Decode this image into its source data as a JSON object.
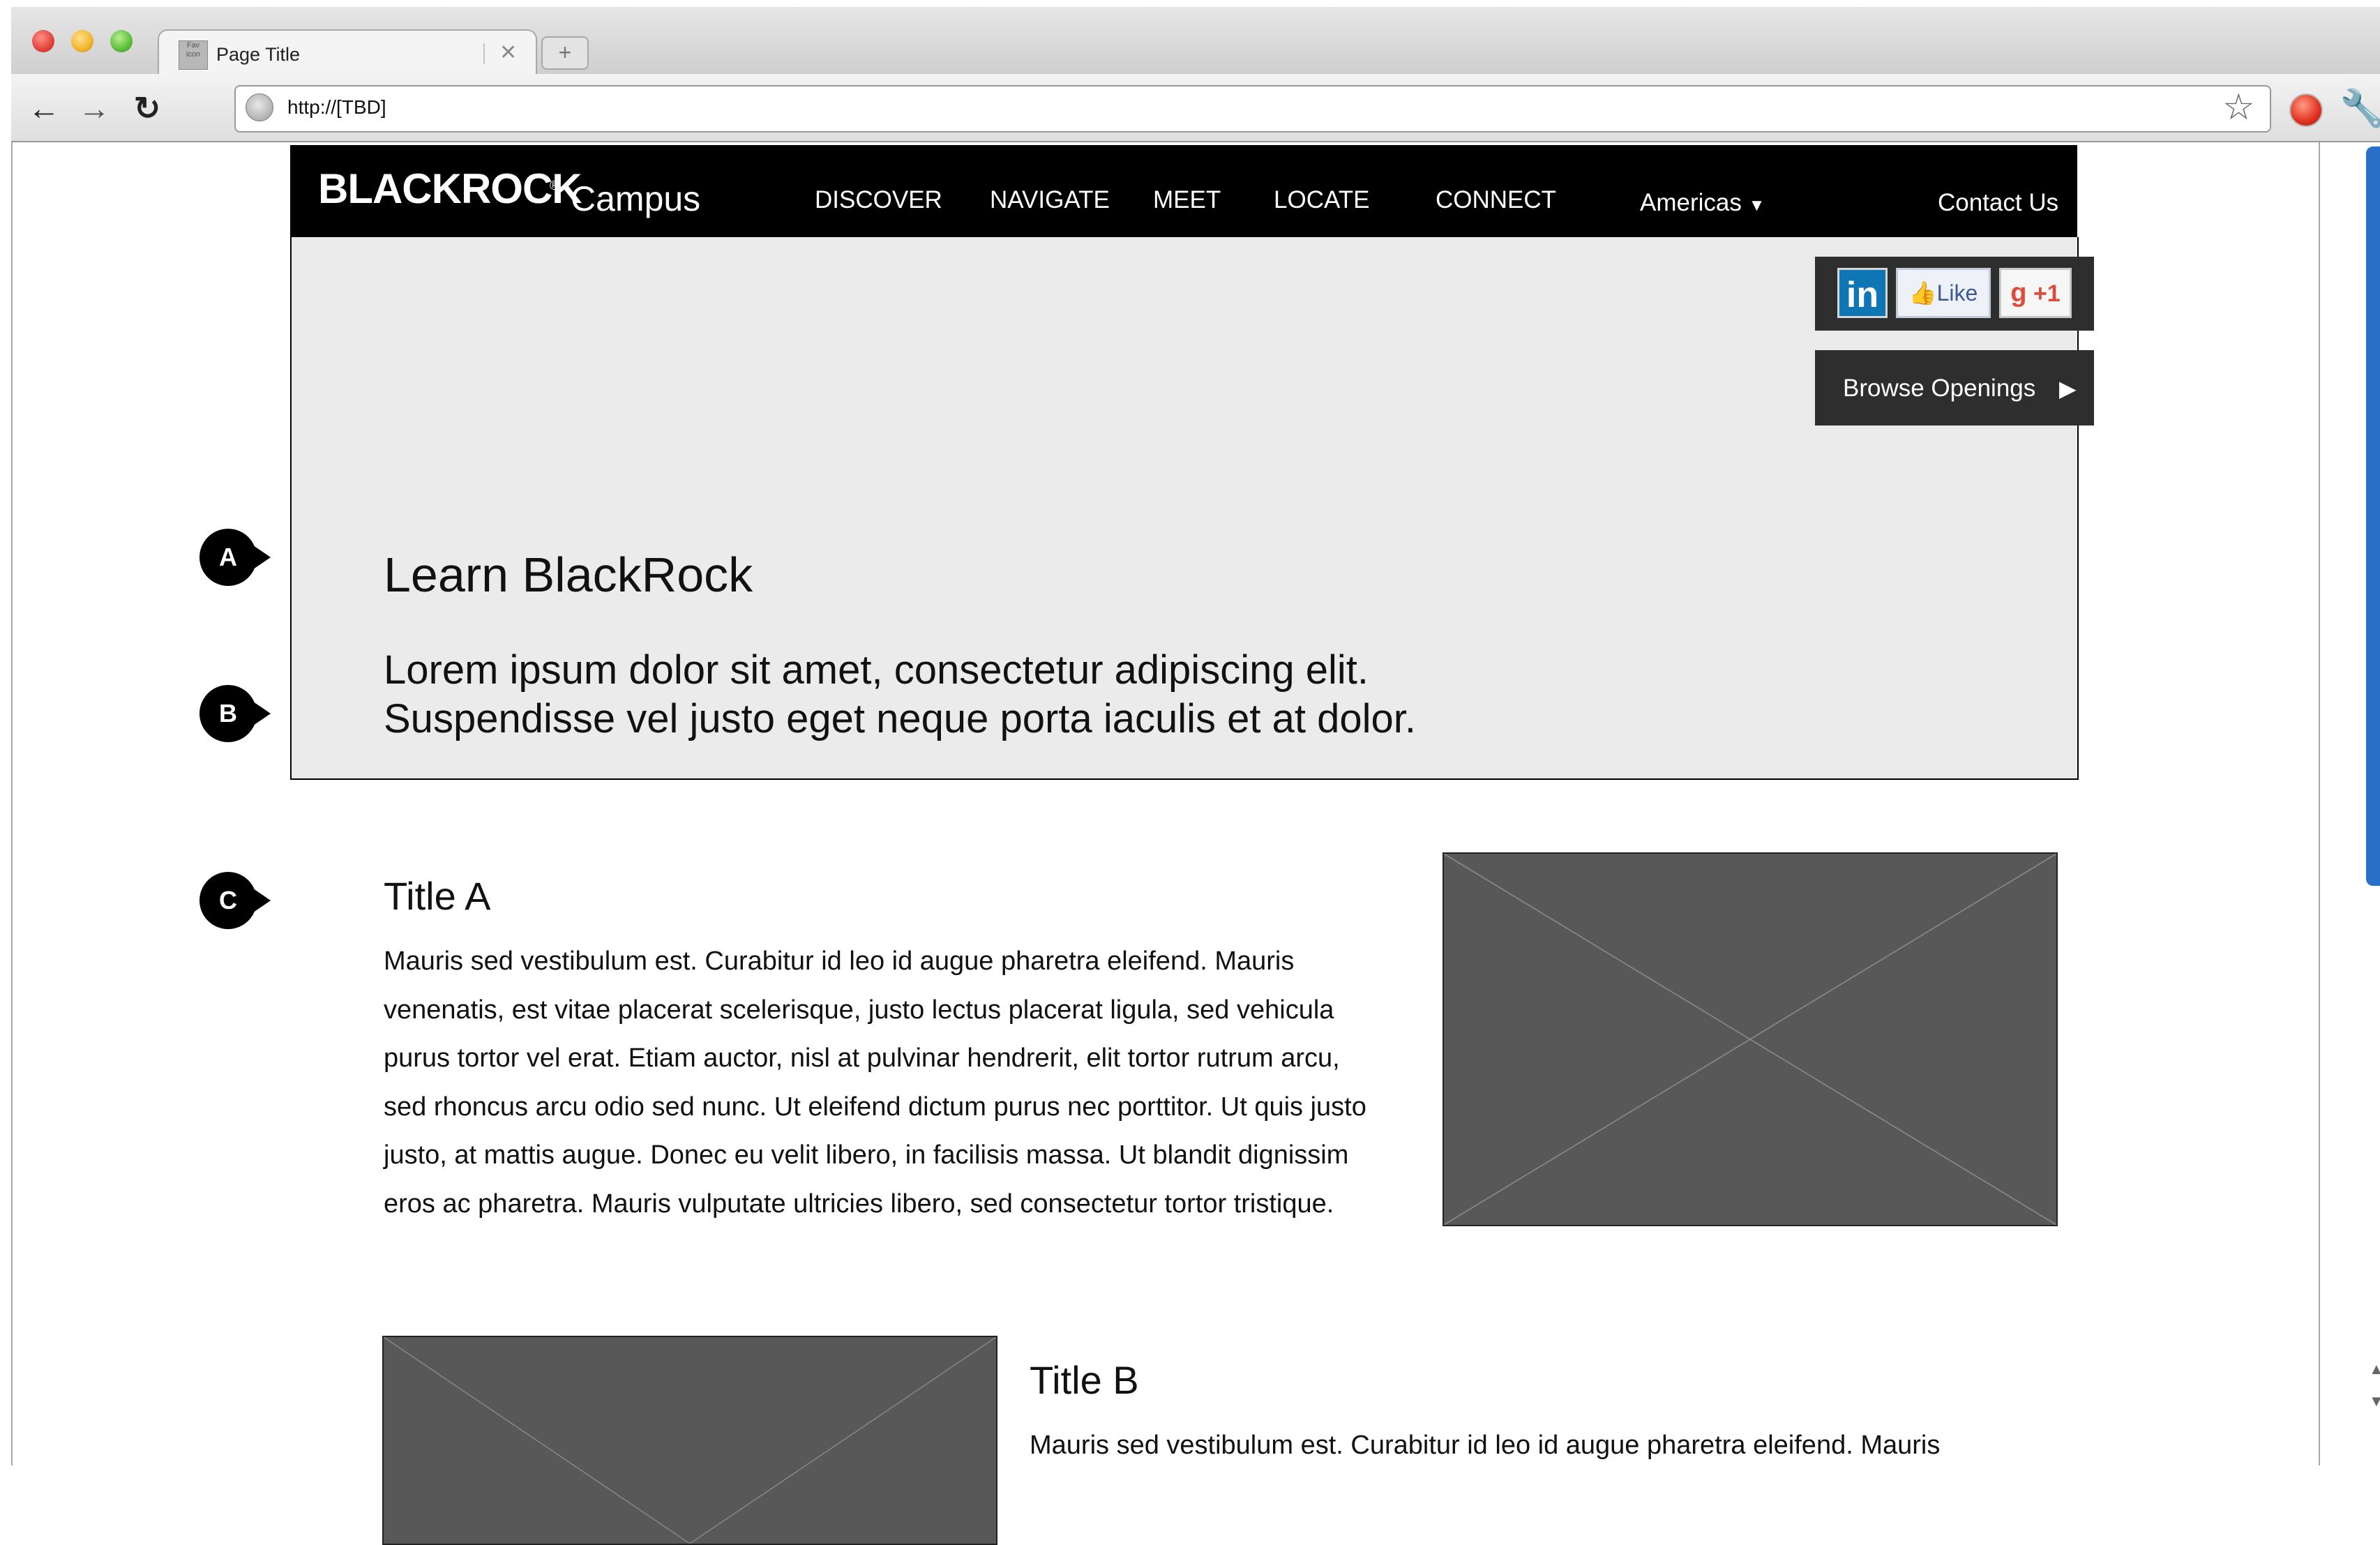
{
  "browser": {
    "tab": {
      "favicon_text": "Fav icon",
      "title": "Page Title",
      "close_glyph": "✕"
    },
    "new_tab_glyph": "+",
    "url": "http://[TBD]"
  },
  "site": {
    "brand": {
      "name": "BLACKROCK",
      "reg": "®",
      "product": "Campus"
    },
    "nav": {
      "items": [
        "DISCOVER",
        "NAVIGATE",
        "MEET",
        "LOCATE",
        "CONNECT"
      ],
      "region": "Americas",
      "region_caret": "▼",
      "contact": "Contact Us"
    },
    "social": {
      "linkedin": "in",
      "like": "Like",
      "plus_one": "+1"
    },
    "browse_openings": "Browse Openings"
  },
  "hero": {
    "title": "Learn BlackRock",
    "subtitle_lines": [
      "Lorem ipsum dolor sit amet, consectetur adipiscing elit.",
      "Suspendisse vel justo eget neque porta iaculis et at dolor."
    ]
  },
  "markers": [
    "A",
    "B",
    "C"
  ],
  "sections": [
    {
      "title": "Title A",
      "body_lines": [
        "Mauris sed vestibulum est. Curabitur id leo id augue pharetra eleifend. Mauris",
        "venenatis, est vitae placerat scelerisque, justo lectus placerat ligula, sed vehicula",
        "purus tortor vel erat. Etiam auctor, nisl at pulvinar hendrerit, elit tortor rutrum arcu,",
        "sed rhoncus arcu odio sed nunc. Ut eleifend dictum purus nec porttitor. Ut quis justo",
        "justo, at mattis augue. Donec eu velit libero, in facilisis massa. Ut blandit dignissim",
        "eros ac pharetra. Mauris vulputate ultricies libero, sed consectetur tortor tristique."
      ]
    },
    {
      "title": "Title B",
      "body_lines": [
        "Mauris sed vestibulum est. Curabitur id leo id augue pharetra eleifend. Mauris"
      ]
    }
  ]
}
